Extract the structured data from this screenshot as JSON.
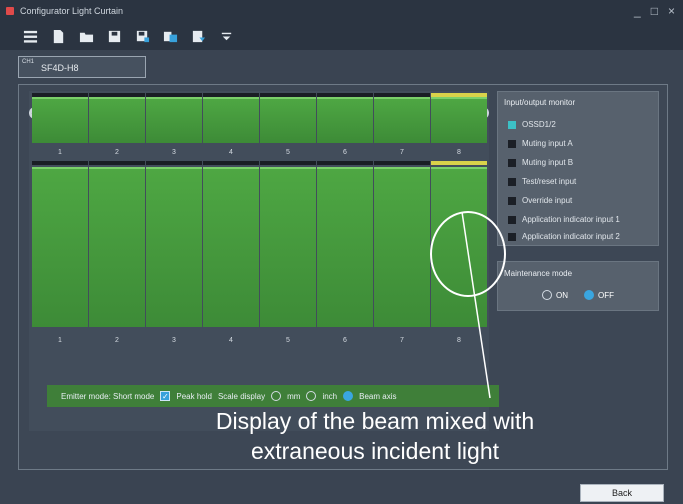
{
  "window": {
    "title": "Configurator Light Curtain",
    "controls": [
      "_",
      "□",
      "×"
    ]
  },
  "toolbar": {
    "icons": [
      "menu-icon",
      "new-file-icon",
      "open-folder-icon",
      "save-icon",
      "save-as-icon",
      "copy-icon",
      "export-icon",
      "dropdown-arrow-icon"
    ]
  },
  "tab": {
    "channel": "CH1",
    "name": "SF4D-H8"
  },
  "beams": {
    "numbers": [
      "1",
      "2",
      "3",
      "4",
      "5",
      "6",
      "7",
      "8"
    ],
    "top_row_fill_levels": [
      1,
      1,
      1,
      1,
      1,
      1,
      1,
      1
    ],
    "bottom_row_fill_levels": [
      1,
      1,
      1,
      1,
      1,
      1,
      1,
      1
    ]
  },
  "options": {
    "emitter_mode": "Emitter mode: Short mode",
    "peak_hold": "Peak hold",
    "peak_hold_checked": true,
    "scale_display": "Scale display",
    "scale_options": [
      "mm",
      "inch",
      "Beam axis"
    ],
    "scale_selected": "Beam axis"
  },
  "io_monitor": {
    "title": "Input/output monitor",
    "items": [
      {
        "label": "OSSD1/2",
        "active": true
      },
      {
        "label": "Muting input A",
        "active": false
      },
      {
        "label": "Muting input B",
        "active": false
      },
      {
        "label": "Test/reset input",
        "active": false
      },
      {
        "label": "Override input",
        "active": false
      },
      {
        "label": "Application indicator input 1",
        "active": false
      },
      {
        "label": "Application indicator input 2",
        "active": false
      }
    ]
  },
  "maintenance": {
    "title": "Maintenance mode",
    "on_label": "ON",
    "off_label": "OFF",
    "selected": "OFF"
  },
  "annotation": {
    "line1": "Display of the beam mixed with",
    "line2": "extraneous incident light"
  },
  "back_button": "Back",
  "colors": {
    "beam_green": "#4ea743",
    "incident_light_yellow": "#d9d24a",
    "active_indicator": "#3cc0c6"
  }
}
